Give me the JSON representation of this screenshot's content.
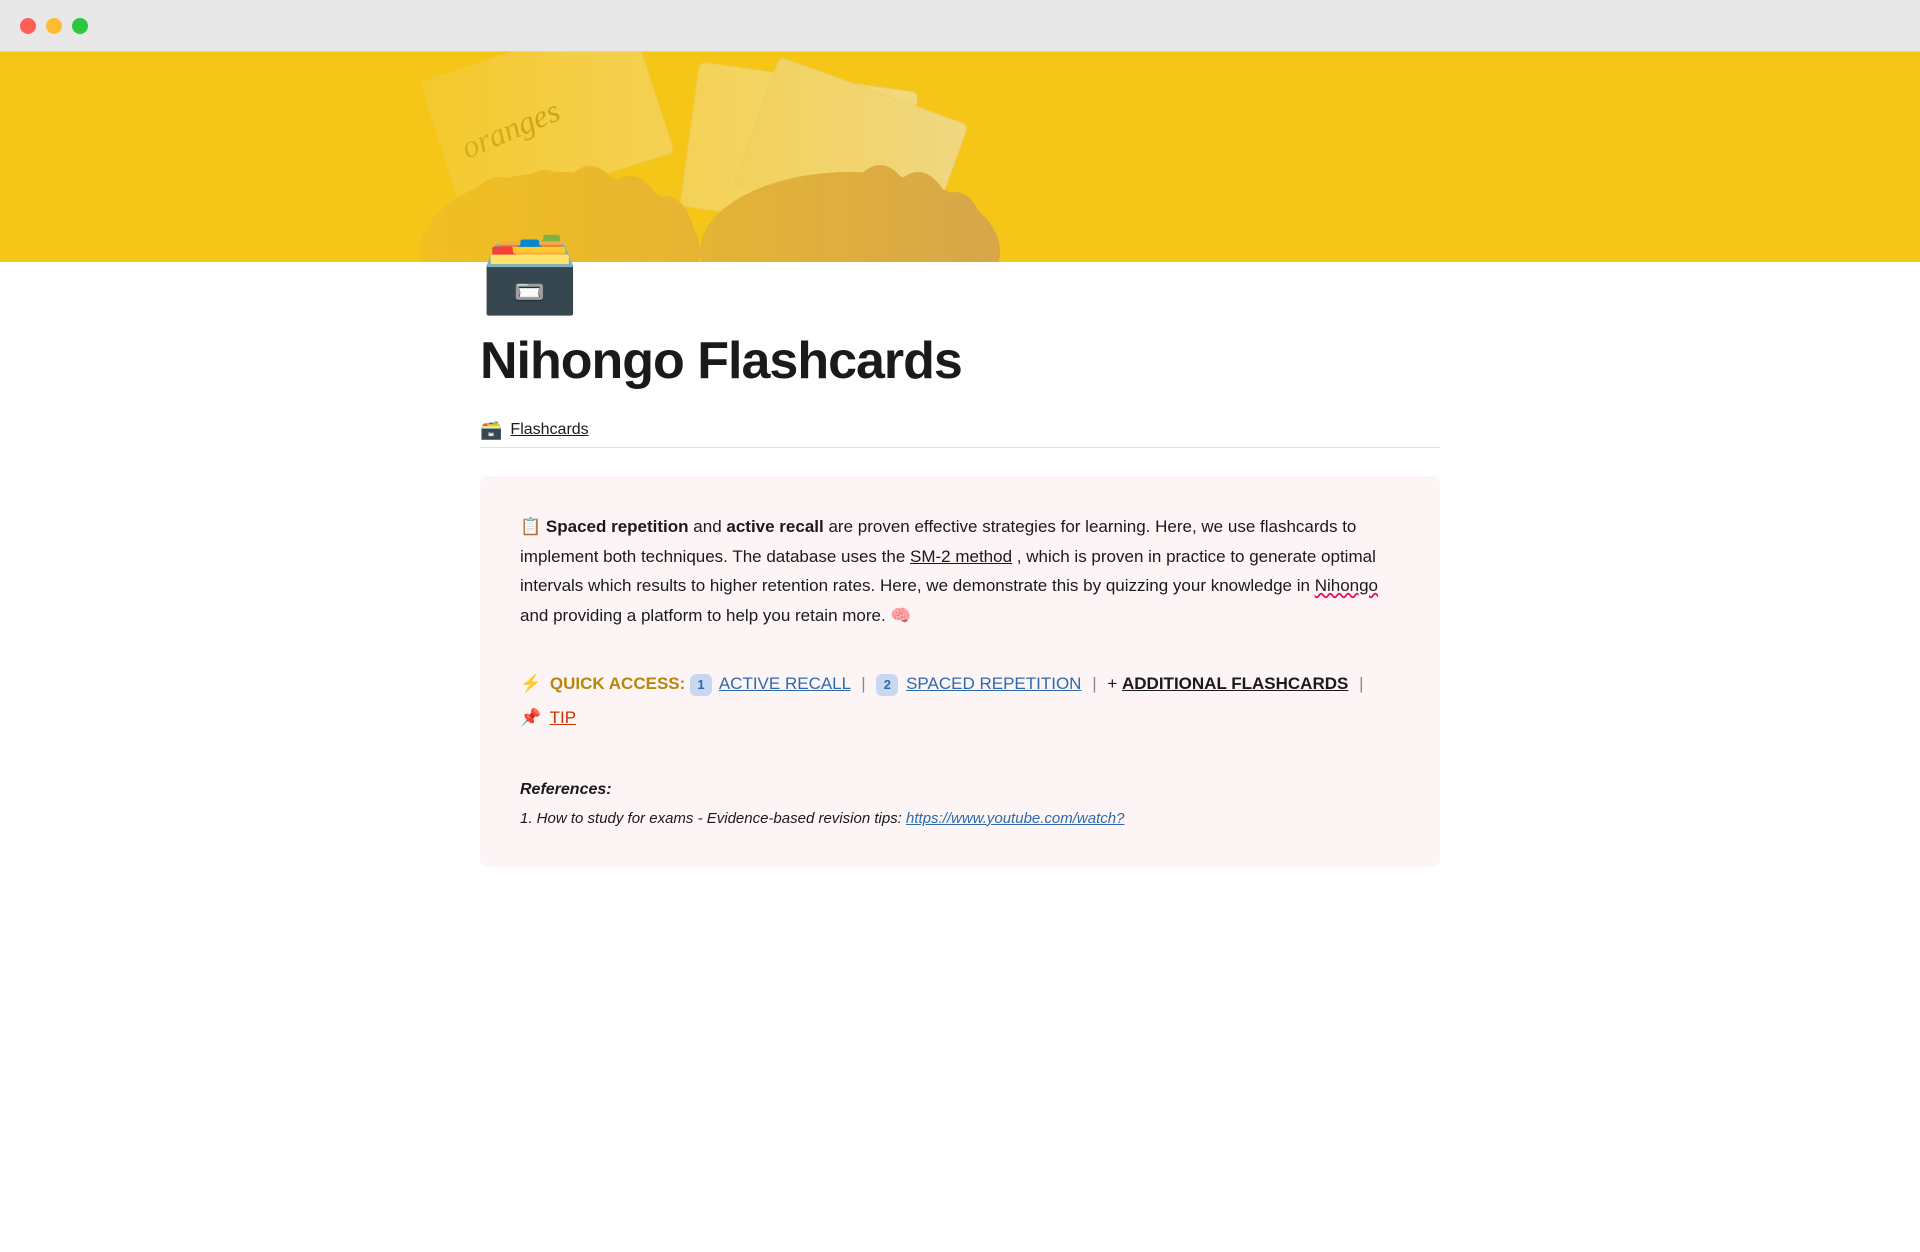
{
  "window": {
    "traffic_lights": {
      "close": "close",
      "minimize": "minimize",
      "maximize": "maximize"
    }
  },
  "hero": {
    "card_text": "oranges"
  },
  "page": {
    "icon": "🗃️",
    "title": "Nihongo Flashcards",
    "breadcrumb_icon": "🗃️",
    "breadcrumb_label": "Flashcards"
  },
  "info_card": {
    "intro_icon": "📋",
    "body_part1": " Spaced repetition",
    "body_part2": " and ",
    "body_part3": "active recall",
    "body_part4": " are proven effective strategies for learning. Here, we use flashcards to implement both techniques. The database uses the ",
    "sm2_link_text": "SM-2 method",
    "body_part5": ", which is proven in practice to generate optimal intervals which results to higher retention rates. Here, we demonstrate this by quizzing your knowledge in ",
    "nihongo_text": "Nihongo",
    "body_part6": " and providing a platform to help you retain more. 🧠"
  },
  "quick_access": {
    "lightning_icon": "⚡",
    "label": "QUICK ACCESS:",
    "badge1": "1️⃣",
    "link1_text": "ACTIVE RECALL",
    "badge2": "2️⃣",
    "link2_text": "SPACED REPETITION",
    "plus": "+ ",
    "link3_text": "ADDITIONAL FLASHCARDS",
    "pin_icon": "📌",
    "link4_text": "TIP"
  },
  "references": {
    "title": "References:",
    "items": [
      {
        "text": "1. How to study for exams - Evidence-based revision tips: ",
        "link_text": "https://www.youtube.com/watch?",
        "link_url": "https://www.youtube.com/watch?"
      }
    ]
  }
}
